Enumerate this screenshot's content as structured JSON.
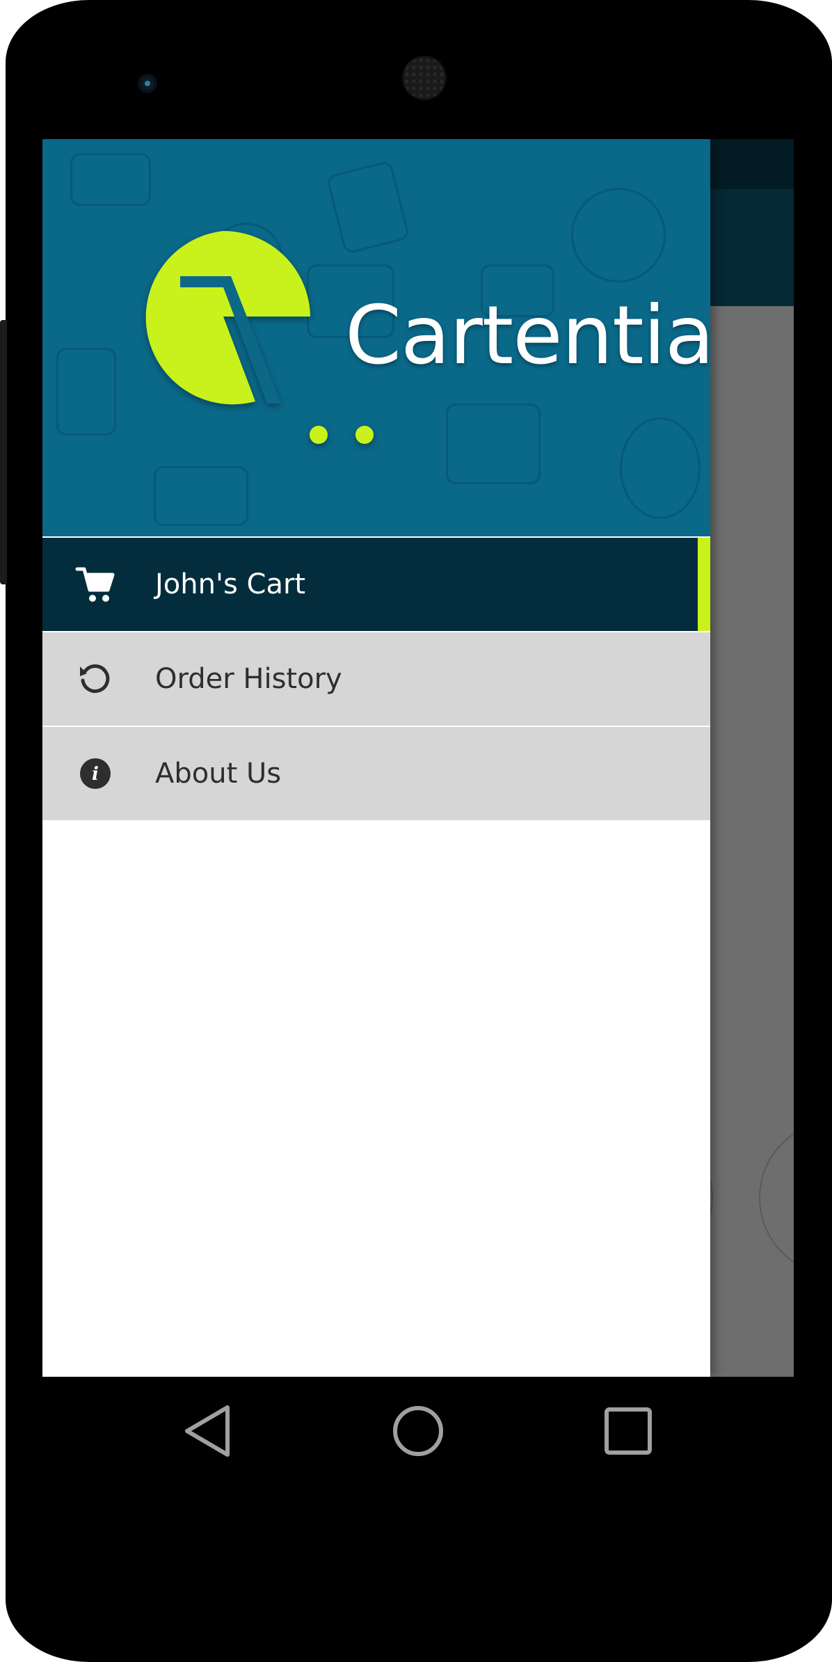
{
  "app": {
    "brand_name": "Cartentia",
    "colors": {
      "header_bg": "#0a6888",
      "toolbar_bg": "#042a36",
      "active_item_bg": "#032d3c",
      "accent": "#c9f21a",
      "inactive_item_bg": "#d6d6d6"
    }
  },
  "drawer": {
    "header": {
      "logo_icon": "cartentia-logo"
    },
    "menu": [
      {
        "label": "John's Cart",
        "icon": "cart-icon",
        "active": true
      },
      {
        "label": "Order History",
        "icon": "history-icon",
        "active": false
      },
      {
        "label": "About Us",
        "icon": "info-icon",
        "active": false
      }
    ]
  },
  "navbar": {
    "back_icon": "back-icon",
    "home_icon": "home-icon",
    "recents_icon": "recents-icon"
  }
}
